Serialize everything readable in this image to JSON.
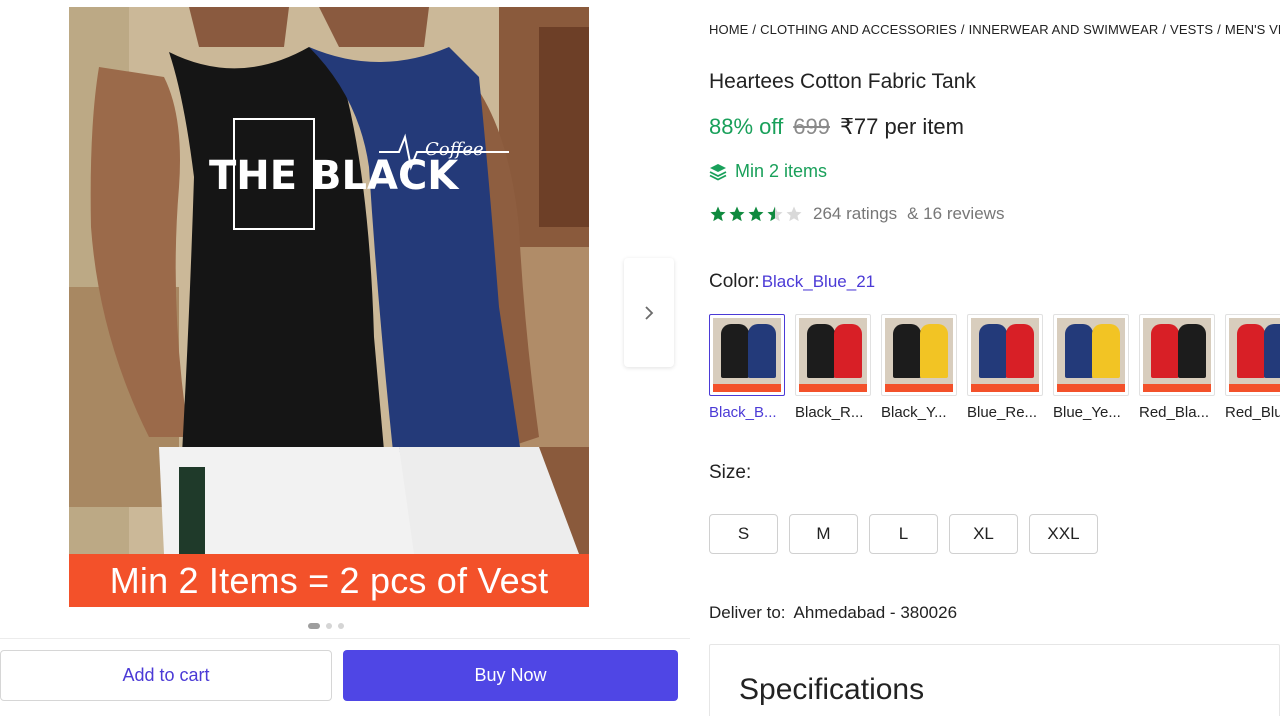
{
  "gallery": {
    "banner_text": "Min 2 Items = 2 pcs of Vest",
    "image_print_left": "THE BLACK",
    "image_print_right": "Coffee",
    "dots_total": 3,
    "dot_active_index": 0,
    "next_icon": "chevron-right-icon"
  },
  "actions": {
    "add_to_cart": "Add to cart",
    "buy_now": "Buy Now"
  },
  "breadcrumb": {
    "items": [
      "HOME",
      "CLOTHING AND ACCESSORIES",
      "INNERWEAR AND SWIMWEAR",
      "VESTS",
      "MEN'S VESTS"
    ]
  },
  "product": {
    "title": "Heartees Cotton Fabric Tank",
    "discount": "88% off",
    "mrp": "699",
    "price": "₹77 per item",
    "min_items": "Min 2 items",
    "min_items_icon": "layers-icon",
    "rating_value": 3.5,
    "ratings": "264 ratings",
    "reviews": "& 16 reviews"
  },
  "color": {
    "label": "Color:",
    "selected": "Black_Blue_21",
    "options": [
      {
        "name": "Black_B...",
        "a": "#1c1c1c",
        "b": "#233a7a",
        "selected": true
      },
      {
        "name": "Black_R...",
        "a": "#1c1c1c",
        "b": "#d81f26",
        "selected": false
      },
      {
        "name": "Black_Y...",
        "a": "#1c1c1c",
        "b": "#f2c424",
        "selected": false
      },
      {
        "name": "Blue_Re...",
        "a": "#233a7a",
        "b": "#d81f26",
        "selected": false
      },
      {
        "name": "Blue_Ye...",
        "a": "#233a7a",
        "b": "#f2c424",
        "selected": false
      },
      {
        "name": "Red_Bla...",
        "a": "#d81f26",
        "b": "#1c1c1c",
        "selected": false
      },
      {
        "name": "Red_Blu...",
        "a": "#d81f26",
        "b": "#233a7a",
        "selected": false
      }
    ]
  },
  "size": {
    "label": "Size:",
    "options": [
      "S",
      "M",
      "L",
      "XL",
      "XXL"
    ]
  },
  "delivery": {
    "label": "Deliver to:",
    "location": "Ahmedabad - 380026"
  },
  "specifications": {
    "title": "Specifications"
  },
  "colors": {
    "accent": "#4f46e5",
    "link": "#4b3ad6",
    "green": "#19a05a",
    "banner": "#f3512a"
  }
}
